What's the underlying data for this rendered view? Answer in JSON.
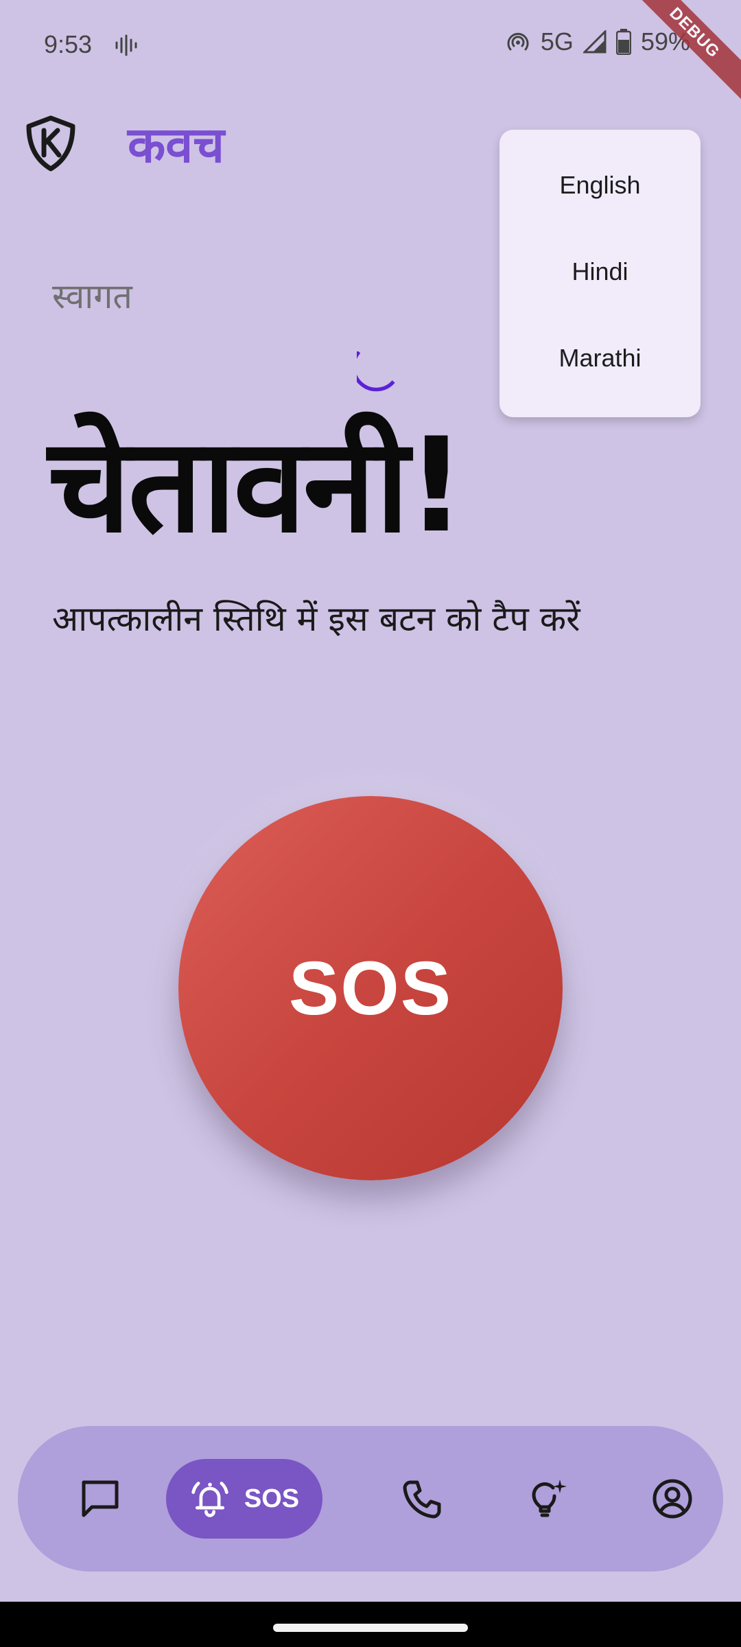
{
  "status_bar": {
    "time": "9:53",
    "network": "5G",
    "battery": "59%"
  },
  "debug_banner": "DEBUG",
  "app_bar": {
    "logo_icon": "shield-k-icon",
    "title": "कवच"
  },
  "language_menu": {
    "options": [
      "English",
      "Hindi",
      "Marathi"
    ]
  },
  "main": {
    "welcome": "स्वागत",
    "headline": "चेतावनी!",
    "instruction": "आपत्कालीन स्तिथि में इस बटन को टैप करें"
  },
  "sos_button": {
    "label": "SOS",
    "color_top": "#dc5e57",
    "color_bottom": "#b73731"
  },
  "bottom_nav": {
    "items": [
      {
        "icon": "chat-icon",
        "label": ""
      },
      {
        "icon": "alarm-bell-icon",
        "label": "SOS",
        "active": true
      },
      {
        "icon": "phone-icon",
        "label": ""
      },
      {
        "icon": "lightbulb-icon",
        "label": ""
      },
      {
        "icon": "profile-icon",
        "label": ""
      }
    ],
    "active_color": "#7a55c4",
    "bar_color": "#af9fda"
  },
  "colors": {
    "background": "#cec3e5",
    "accent": "#7a4fd1",
    "spinner": "#5b21d6"
  }
}
